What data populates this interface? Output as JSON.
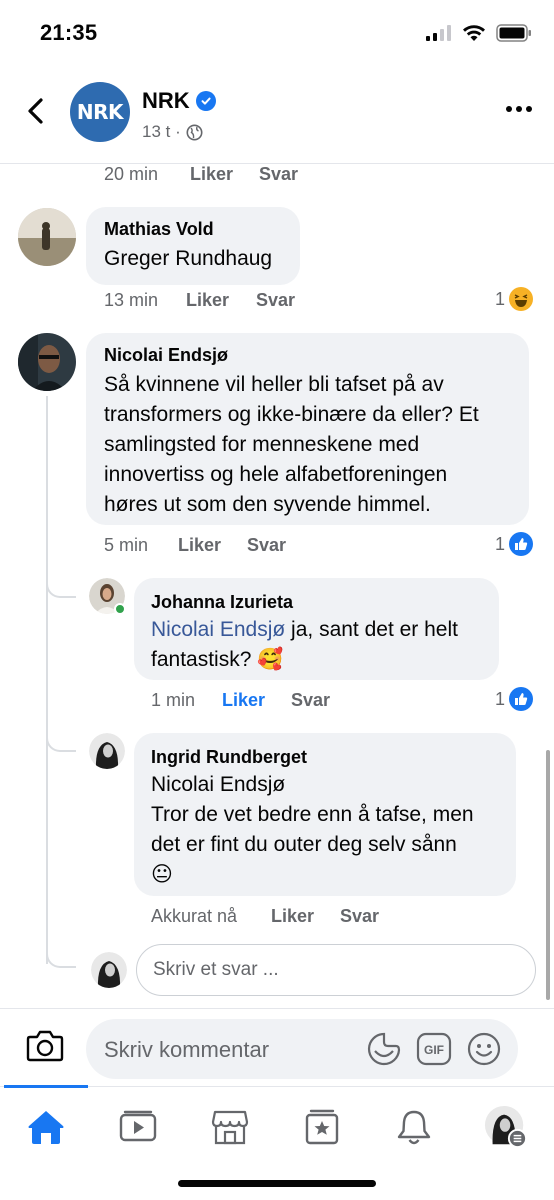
{
  "status_bar": {
    "time": "21:35"
  },
  "header": {
    "logo_text": "NRK",
    "page_name": "NRK",
    "meta": "13 t ·"
  },
  "prev_comment_actions": {
    "time": "20 min",
    "like": "Liker",
    "reply": "Svar"
  },
  "comments": [
    {
      "author": "Mathias Vold",
      "mention": "Greger Rundhaug",
      "text": "",
      "time": "13 min",
      "like": "Liker",
      "reply": "Svar",
      "reaction_count": "1",
      "reaction": "haha"
    },
    {
      "author": "Nicolai Endsjø",
      "lines": [
        "Så kvinnene vil heller bli tafset på av",
        "transformers og ikke-binære da eller? Et",
        "samlingsted for menneskene med",
        "innovertiss og hele alfabetforeningen",
        "høres ut som den syvende himmel."
      ],
      "time": "5 min",
      "like": "Liker",
      "reply": "Svar",
      "reaction_count": "1",
      "reaction": "like"
    }
  ],
  "replies": [
    {
      "author": "Johanna Izurieta",
      "mention": "Nicolai Endsjø",
      "line1_rest": " ja, sant det er helt",
      "line2": "fantastisk? 🥰",
      "time": "1 min",
      "like": "Liker",
      "reply": "Svar",
      "reaction_count": "1",
      "reaction": "like",
      "liked_by_me": true
    },
    {
      "author": "Ingrid Rundberget",
      "mention": "Nicolai Endsjø",
      "lines": [
        "Tror de vet bedre enn å tafse, men",
        "det er fint du outer deg selv sånn",
        "😐"
      ],
      "time": "Akkurat nå",
      "like": "Liker",
      "reply": "Svar"
    }
  ],
  "reply_input": {
    "placeholder": "Skriv et svar ..."
  },
  "composer": {
    "placeholder": "Skriv kommentar",
    "gif_label": "GIF"
  },
  "tabs": [
    "home",
    "watch",
    "marketplace",
    "pages",
    "notifications",
    "profile-menu"
  ],
  "colors": {
    "accent": "#1877f2",
    "bubble": "#f0f2f5",
    "mention": "#385898",
    "nrk_blue": "#2e6bb0"
  }
}
